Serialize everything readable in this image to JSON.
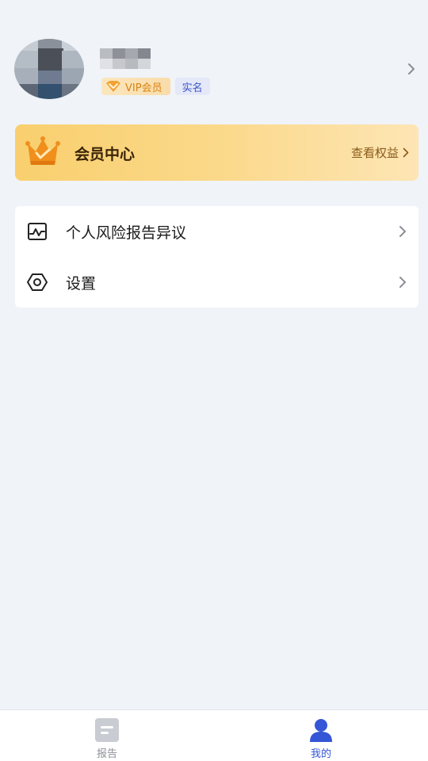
{
  "profile": {
    "vip_badge": "VIP会员",
    "realname_badge": "实名"
  },
  "member_card": {
    "title": "会员中心",
    "link": "查看权益"
  },
  "menu": {
    "items": [
      {
        "label": "个人风险报告异议",
        "icon": "chart-line-icon"
      },
      {
        "label": "设置",
        "icon": "settings-hexagon-icon"
      }
    ]
  },
  "tabbar": {
    "tabs": [
      {
        "label": "报告",
        "icon": "report-doc-icon",
        "active": false
      },
      {
        "label": "我的",
        "icon": "user-person-icon",
        "active": true
      }
    ],
    "active_color": "#3556d6",
    "inactive_color": "#8c8f95"
  },
  "colors": {
    "page_background": "#f0f3f7",
    "member_gold": "#f9cf6e",
    "vip_orange": "#d88412",
    "realname_blue": "#3d56c9"
  }
}
